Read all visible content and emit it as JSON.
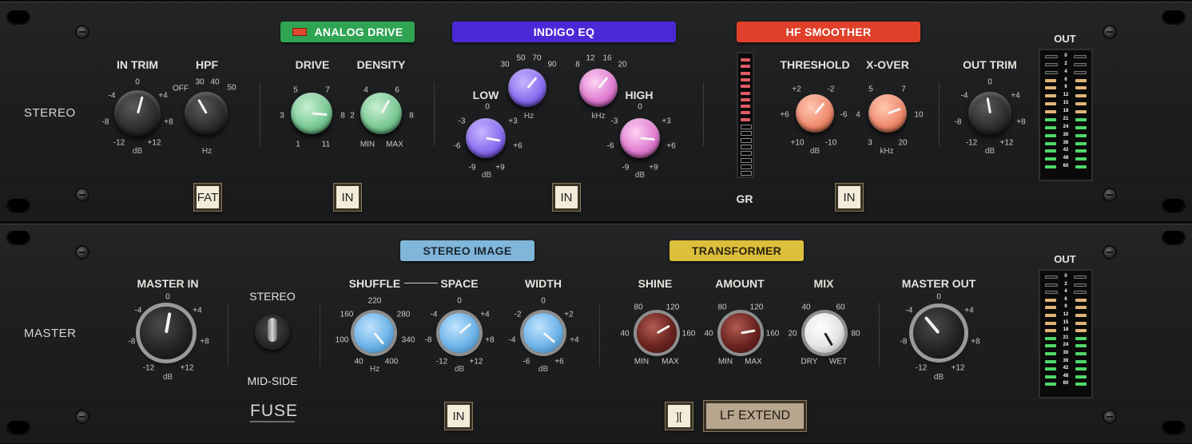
{
  "top": {
    "row_label": "STEREO",
    "sections": {
      "analog_drive": {
        "label": "ANALOG DRIVE",
        "color": "#2fa452"
      },
      "indigo_eq": {
        "label": "INDIGO EQ",
        "color": "#4b28d6"
      },
      "hf_smoother": {
        "label": "HF SMOOTHER",
        "color": "#e0402a"
      }
    },
    "in_trim": {
      "label": "IN TRIM",
      "scale": [
        "-12",
        "-8",
        "-4",
        "0",
        "+4",
        "+8",
        "+12"
      ],
      "unit": "dB"
    },
    "hpf": {
      "label": "HPF",
      "scale": [
        "OFF",
        "30",
        "40",
        "50"
      ],
      "unit": "Hz"
    },
    "drive": {
      "label": "DRIVE",
      "scale": [
        "1",
        "3",
        "5",
        "7",
        "8",
        "11"
      ]
    },
    "density": {
      "label": "DENSITY",
      "scale": [
        "MIN",
        "2",
        "4",
        "6",
        "8",
        "MAX"
      ]
    },
    "eq_low_freq": {
      "scale": [
        "30",
        "50",
        "70",
        "90"
      ],
      "unit": "Hz"
    },
    "eq_low": {
      "label": "LOW",
      "scale": [
        "-9",
        "-6",
        "-3",
        "0",
        "+3",
        "+6",
        "+9"
      ],
      "unit": "dB"
    },
    "eq_high_freq": {
      "scale": [
        "8",
        "12",
        "16",
        "20"
      ],
      "unit": "kHz"
    },
    "eq_high": {
      "label": "HIGH",
      "scale": [
        "-9",
        "-6",
        "-3",
        "0",
        "+3",
        "+6",
        "+9"
      ],
      "unit": "dB"
    },
    "gr_meter": {
      "label": "GR"
    },
    "threshold": {
      "label": "THRESHOLD",
      "scale": [
        "+10",
        "+6",
        "+2",
        "-2",
        "-6",
        "-10"
      ],
      "unit": "dB"
    },
    "xover": {
      "label": "X-OVER",
      "scale": [
        "3",
        "4",
        "5",
        "7",
        "10",
        "20"
      ],
      "unit": "kHz"
    },
    "out_trim": {
      "label": "OUT TRIM",
      "scale": [
        "-12",
        "-8",
        "-4",
        "0",
        "+4",
        "+8",
        "+12"
      ],
      "unit": "dB"
    },
    "out_meter": {
      "label": "OUT"
    },
    "buttons": {
      "fat": "FAT",
      "drive_in": "IN",
      "eq_in": "IN",
      "hf_in": "IN"
    }
  },
  "bottom": {
    "row_label": "MASTER",
    "sections": {
      "stereo_image": {
        "label": "STEREO IMAGE",
        "color": "#7fb6d9"
      },
      "transformer": {
        "label": "TRANSFORMER",
        "color": "#dcbf3a"
      }
    },
    "master_in": {
      "label": "MASTER IN",
      "scale": [
        "-12",
        "-8",
        "-4",
        "0",
        "+4",
        "+8",
        "+12"
      ],
      "unit": "dB"
    },
    "mode_switch": {
      "top": "STEREO",
      "bottom": "MID-SIDE"
    },
    "shuffle": {
      "label": "SHUFFLE",
      "scale": [
        "40",
        "100",
        "160",
        "220",
        "280",
        "340",
        "400"
      ],
      "unit": "Hz"
    },
    "space": {
      "label": "SPACE",
      "scale": [
        "-12",
        "-8",
        "-4",
        "0",
        "+4",
        "+8",
        "+12"
      ],
      "unit": "dB"
    },
    "width": {
      "label": "WIDTH",
      "scale": [
        "-6",
        "-4",
        "-2",
        "0",
        "+2",
        "+4",
        "+6"
      ],
      "unit": "dB"
    },
    "shine": {
      "label": "SHINE",
      "scale": [
        "MIN",
        "40",
        "80",
        "120",
        "160",
        "MAX"
      ]
    },
    "amount": {
      "label": "AMOUNT",
      "scale": [
        "MIN",
        "40",
        "80",
        "120",
        "160",
        "MAX"
      ]
    },
    "mix": {
      "label": "MIX",
      "scale": [
        "DRY",
        "20",
        "40",
        "60",
        "80",
        "WET"
      ]
    },
    "master_out": {
      "label": "MASTER OUT",
      "scale": [
        "-12",
        "-8",
        "-4",
        "0",
        "+4",
        "+8",
        "+12"
      ],
      "unit": "dB"
    },
    "out_meter": {
      "label": "OUT"
    },
    "logo": "FUSE",
    "buttons": {
      "stereo_in": "IN",
      "lf_extend": "LF EXTEND"
    }
  },
  "meter_scale": [
    "0",
    "2",
    "4",
    "6",
    "9",
    "12",
    "15",
    "18",
    "21",
    "24",
    "30",
    "36",
    "42",
    "48",
    "60"
  ]
}
